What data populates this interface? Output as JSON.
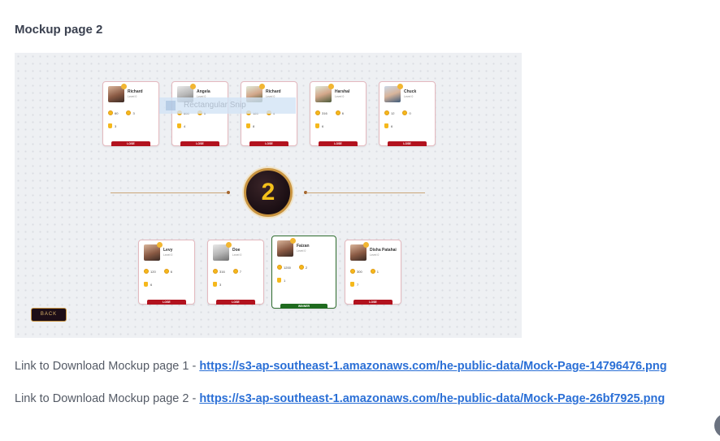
{
  "heading": "Mockup page 2",
  "mockup": {
    "top_players": [
      {
        "name": "Richard",
        "level": "Level 0",
        "coins": "60",
        "gems": "3",
        "trophies": "3",
        "result": "LOSE",
        "avatar": "dark"
      },
      {
        "name": "Angela",
        "level": "Level 0",
        "coins": "800",
        "gems": "5",
        "trophies": "4",
        "result": "LOSE",
        "avatar": "light"
      },
      {
        "name": "Richard",
        "level": "Level 0",
        "coins": "120",
        "gems": "4",
        "trophies": "8",
        "result": "LOSE",
        "avatar": "green"
      },
      {
        "name": "Harshal",
        "level": "Level 0",
        "coins": "316",
        "gems": "6",
        "trophies": "6",
        "result": "LOSE",
        "avatar": "green"
      },
      {
        "name": "Chuck",
        "level": "Level 0",
        "coins": "12",
        "gems": "0",
        "trophies": "6",
        "result": "LOSE",
        "avatar": "blue"
      }
    ],
    "bottom_players": [
      {
        "name": "Levy",
        "level": "Level 0",
        "coins": "120",
        "gems": "6",
        "trophies": "6",
        "result": "LOSE",
        "avatar": "dark"
      },
      {
        "name": "Doe",
        "level": "Level 0",
        "coins": "316",
        "gems": "7",
        "trophies": "3",
        "result": "LOSE",
        "avatar": "light"
      },
      {
        "name": "Faizan",
        "level": "Level 0",
        "coins": "1200",
        "gems": "2",
        "trophies": "1",
        "result": "WINNER",
        "avatar": "dark"
      },
      {
        "name": "Disha Patahai",
        "level": "Level 0",
        "coins": "300",
        "gems": "1",
        "trophies": "7",
        "result": "LOSE",
        "avatar": "dark"
      }
    ],
    "rank": "2",
    "overlay_label": "Rectangular Snip",
    "back_label": "BACK"
  },
  "links": [
    {
      "prefix": "Link to Download Mockup page 1 - ",
      "url": "https://s3-ap-southeast-1.amazonaws.com/he-public-data/Mock-Page-14796476.png"
    },
    {
      "prefix": "Link to Download Mockup page 2 - ",
      "url": "https://s3-ap-southeast-1.amazonaws.com/he-public-data/Mock-Page-26bf7925.png"
    }
  ],
  "colors": {
    "link": "#2a6fd6",
    "lose": "#b2121e",
    "winner": "#1f6b1f",
    "badge_gold": "#f4c01a"
  }
}
